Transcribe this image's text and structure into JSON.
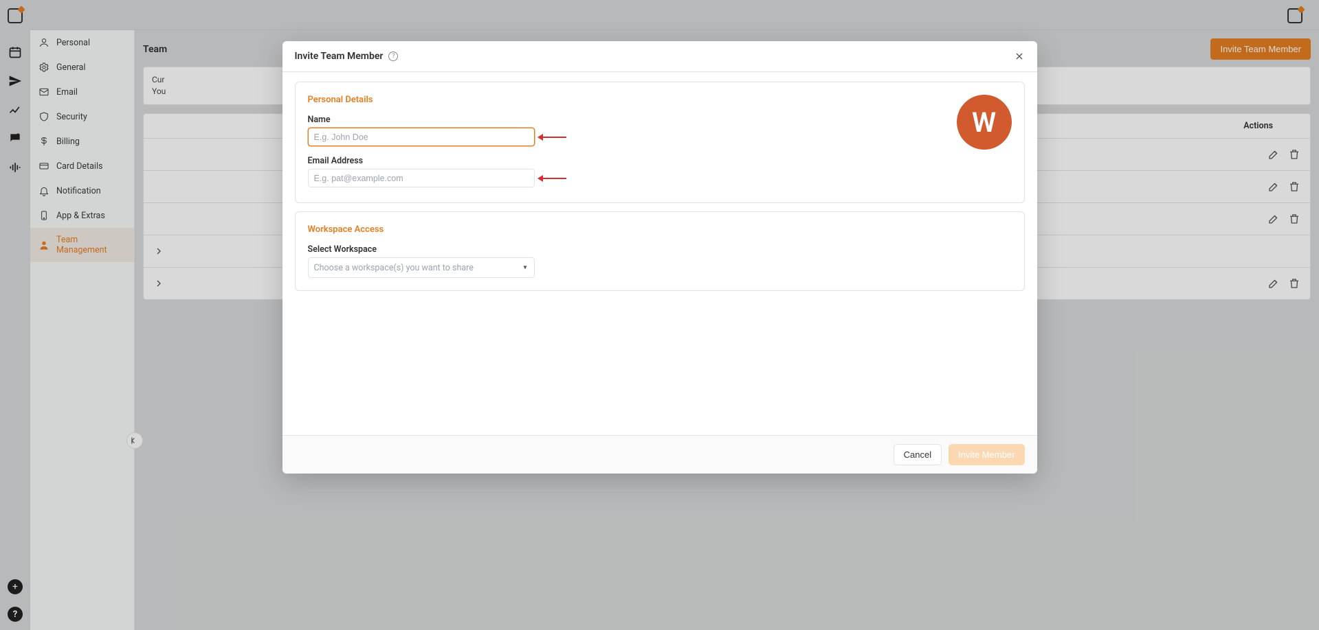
{
  "brand_initial": "W",
  "rail": {
    "icons": [
      "logo",
      "calendar",
      "send",
      "bar-chart",
      "chat",
      "audio"
    ]
  },
  "settings_sidebar": {
    "items": [
      {
        "label": "Personal",
        "icon": "user-icon",
        "active": false
      },
      {
        "label": "General",
        "icon": "gear-icon",
        "active": false
      },
      {
        "label": "Email",
        "icon": "mail-icon",
        "active": false
      },
      {
        "label": "Security",
        "icon": "shield-icon",
        "active": false
      },
      {
        "label": "Billing",
        "icon": "dollar-icon",
        "active": false
      },
      {
        "label": "Card Details",
        "icon": "card-icon",
        "active": false
      },
      {
        "label": "Notification",
        "icon": "bell-icon",
        "active": false
      },
      {
        "label": "App & Extras",
        "icon": "phone-icon",
        "active": false
      },
      {
        "label": "Team Management",
        "icon": "person-icon",
        "active": true
      }
    ]
  },
  "page": {
    "title_prefix": "Team",
    "banner_line1": "Cur",
    "banner_line2": "You",
    "invite_button": "Invite Team Member",
    "table": {
      "actions_header": "Actions",
      "rows": 5
    }
  },
  "modal": {
    "title": "Invite Team Member",
    "sections": {
      "personal": {
        "heading": "Personal Details",
        "name_label": "Name",
        "name_placeholder": "E.g. John Doe",
        "email_label": "Email Address",
        "email_placeholder": "E.g. pat@example.com"
      },
      "workspace": {
        "heading": "Workspace Access",
        "select_label": "Select Workspace",
        "select_placeholder": "Choose a workspace(s) you want to share"
      }
    },
    "footer": {
      "cancel": "Cancel",
      "invite": "Invite Member"
    }
  }
}
